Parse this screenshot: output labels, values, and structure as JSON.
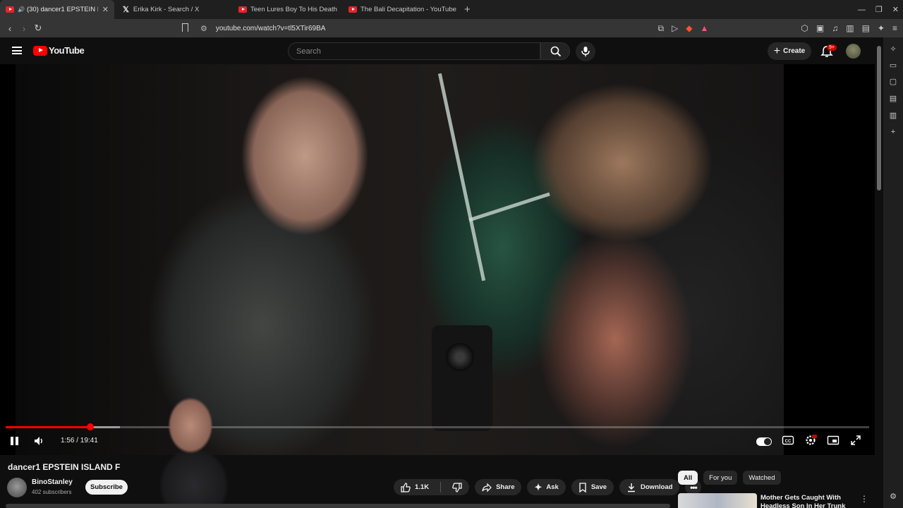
{
  "browser": {
    "tabs": [
      {
        "title": "(30) dancer1 EPSTEIN ISL...",
        "icon": "youtube-icon",
        "active": true
      },
      {
        "title": "Erika Kirk - Search / X",
        "icon": "x-icon",
        "active": false
      },
      {
        "title": "Teen Lures Boy To His Death, Th",
        "icon": "youtube-icon",
        "active": false
      },
      {
        "title": "The Bali Decapitation - YouTube",
        "icon": "youtube-icon",
        "active": false
      }
    ],
    "new_tab": "+",
    "url": "youtube.com/watch?v=tl5XTir69BA"
  },
  "youtube": {
    "logo_text": "YouTube",
    "search_placeholder": "Search",
    "create_label": "Create",
    "notification_badge": "9+",
    "accent": "#ff0000"
  },
  "player": {
    "time_display": "1:56 / 19:41",
    "progress_played_fraction": 0.098,
    "progress_loaded_fraction": 0.132
  },
  "video_info": {
    "title": "dancer1 EPSTEIN ISLAND F",
    "channel": "BinoStanley",
    "subscribers": "402 subscribers",
    "subscribe_label": "Subscribe",
    "like_count": "1.1K",
    "share_label": "Share",
    "ask_label": "Ask",
    "save_label": "Save",
    "download_label": "Download"
  },
  "recommendations": {
    "chips": [
      "All",
      "For you",
      "Watched"
    ],
    "first_title": "Mother Gets Caught With Headless Son In Her Trunk"
  }
}
